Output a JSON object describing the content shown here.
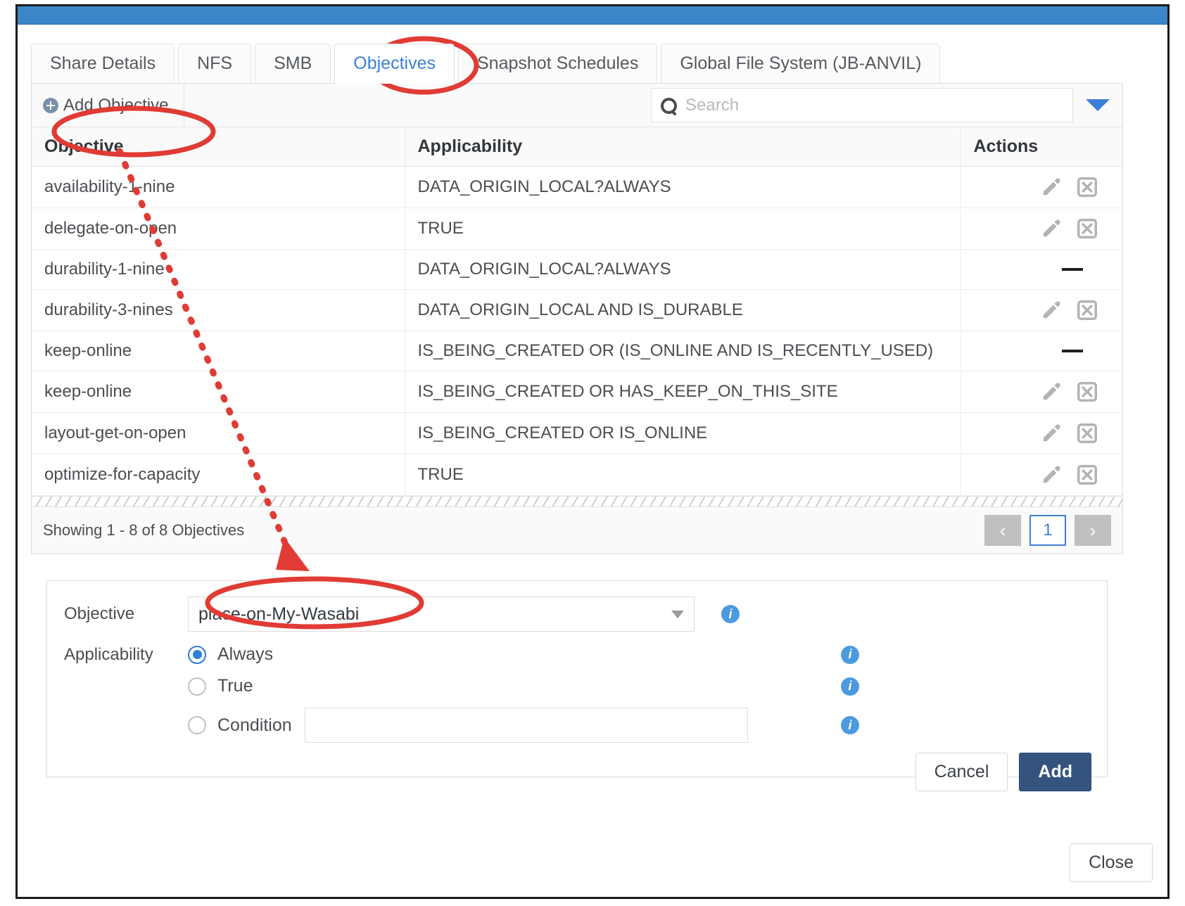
{
  "tabs": [
    {
      "label": "Share Details",
      "active": false
    },
    {
      "label": "NFS",
      "active": false
    },
    {
      "label": "SMB",
      "active": false
    },
    {
      "label": "Objectives",
      "active": true
    },
    {
      "label": "Snapshot Schedules",
      "active": false
    },
    {
      "label": "Global File System (JB-ANVIL)",
      "active": false
    }
  ],
  "toolbar": {
    "add_label": "Add Objective",
    "add_icon": "plus-circle-icon",
    "search_placeholder": "Search",
    "search_value": "",
    "search_icon": "search-icon",
    "filter_icon": "chevron-down-icon"
  },
  "table": {
    "columns": [
      "Objective",
      "Applicability",
      "Actions"
    ],
    "rows": [
      {
        "objective": "availability-1-nine",
        "applicability": "DATA_ORIGIN_LOCAL?ALWAYS",
        "actions": "edit-delete"
      },
      {
        "objective": "delegate-on-open",
        "applicability": "TRUE",
        "actions": "edit-delete"
      },
      {
        "objective": "durability-1-nine",
        "applicability": "DATA_ORIGIN_LOCAL?ALWAYS",
        "actions": "none"
      },
      {
        "objective": "durability-3-nines",
        "applicability": "DATA_ORIGIN_LOCAL AND IS_DURABLE",
        "actions": "edit-delete"
      },
      {
        "objective": "keep-online",
        "applicability": "IS_BEING_CREATED OR (IS_ONLINE AND IS_RECENTLY_USED)",
        "actions": "none"
      },
      {
        "objective": "keep-online",
        "applicability": "IS_BEING_CREATED OR HAS_KEEP_ON_THIS_SITE",
        "actions": "edit-delete"
      },
      {
        "objective": "layout-get-on-open",
        "applicability": "IS_BEING_CREATED OR IS_ONLINE",
        "actions": "edit-delete"
      },
      {
        "objective": "optimize-for-capacity",
        "applicability": "TRUE",
        "actions": "edit-delete"
      }
    ]
  },
  "footer": {
    "showing": "Showing 1 - 8 of 8 Objectives",
    "prev": "‹",
    "page": "1",
    "next": "›"
  },
  "form": {
    "objective_label": "Objective",
    "objective_value": "place-on-My-Wasabi",
    "applicability_label": "Applicability",
    "options": [
      {
        "label": "Always",
        "selected": true
      },
      {
        "label": "True",
        "selected": false
      },
      {
        "label": "Condition",
        "selected": false
      }
    ],
    "condition_value": "",
    "info_icon": "info-icon",
    "cancel_label": "Cancel",
    "add_label": "Add"
  },
  "dialog": {
    "close_label": "Close"
  },
  "colors": {
    "accent": "#3e7fd6",
    "primary_button": "#34547e",
    "title_bar": "#3a86c8",
    "annotation": "#e03b34",
    "info": "#4b9ae0"
  }
}
